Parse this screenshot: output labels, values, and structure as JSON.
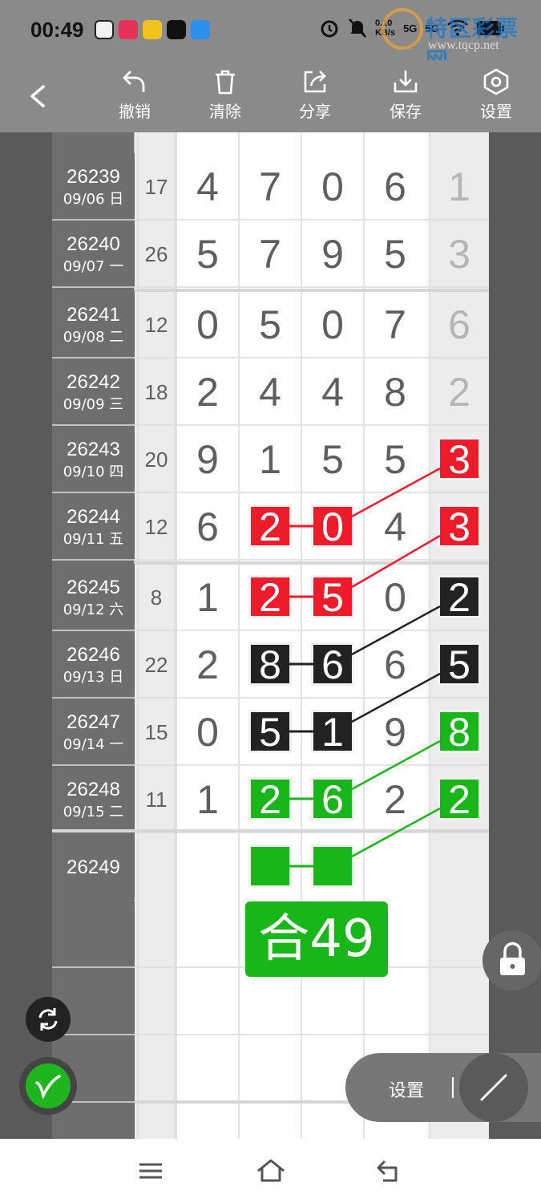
{
  "status": {
    "time": "00:49",
    "net_speed_value": "0.10",
    "net_speed_unit": "KB/s",
    "network_5g_1": "5G",
    "network_5g_2": "5G"
  },
  "watermark": {
    "title": "特区彩票网",
    "url": "www.tqcp.net"
  },
  "toolbar": {
    "undo": "撤销",
    "clear": "清除",
    "share": "分享",
    "save": "保存",
    "settings": "设置"
  },
  "rows": [
    {
      "issue": "26239",
      "date": "09/06 日",
      "sum": "17",
      "d": [
        "4",
        "7",
        "0",
        "6"
      ],
      "last": "1"
    },
    {
      "issue": "26240",
      "date": "09/07 一",
      "sum": "26",
      "d": [
        "5",
        "7",
        "9",
        "5"
      ],
      "last": "3"
    },
    {
      "issue": "26241",
      "date": "09/08 二",
      "sum": "12",
      "d": [
        "0",
        "5",
        "0",
        "7"
      ],
      "last": "6"
    },
    {
      "issue": "26242",
      "date": "09/09 三",
      "sum": "18",
      "d": [
        "2",
        "4",
        "4",
        "8"
      ],
      "last": "2"
    },
    {
      "issue": "26243",
      "date": "09/10 四",
      "sum": "20",
      "d": [
        "9",
        "1",
        "5",
        "5"
      ],
      "last": "3"
    },
    {
      "issue": "26244",
      "date": "09/11 五",
      "sum": "12",
      "d": [
        "6",
        "2",
        "0",
        "4"
      ],
      "last": "3"
    },
    {
      "issue": "26245",
      "date": "09/12 六",
      "sum": "8",
      "d": [
        "1",
        "2",
        "5",
        "0"
      ],
      "last": "2"
    },
    {
      "issue": "26246",
      "date": "09/13 日",
      "sum": "22",
      "d": [
        "2",
        "8",
        "6",
        "6"
      ],
      "last": "5"
    },
    {
      "issue": "26247",
      "date": "09/14 一",
      "sum": "15",
      "d": [
        "0",
        "5",
        "1",
        "9"
      ],
      "last": "8"
    },
    {
      "issue": "26248",
      "date": "09/15 二",
      "sum": "11",
      "d": [
        "1",
        "2",
        "6",
        "2"
      ],
      "last": "2"
    }
  ],
  "next_issue": "26249",
  "result_label": "合49",
  "colors": {
    "red": "#ee1c2a",
    "black": "#222222",
    "green": "#19b619",
    "digit_gray": "#5f5f5f"
  },
  "highlights": [
    {
      "row": 4,
      "cells": [
        4
      ],
      "color": "red"
    },
    {
      "row": 5,
      "cells": [
        1,
        2,
        4
      ],
      "color": "red"
    },
    {
      "row": 6,
      "cells": [
        1,
        2
      ],
      "color": "red"
    },
    {
      "row": 6,
      "cells": [
        4
      ],
      "color": "black"
    },
    {
      "row": 7,
      "cells": [
        1,
        2,
        4
      ],
      "color": "black"
    },
    {
      "row": 8,
      "cells": [
        1,
        2
      ],
      "color": "black"
    },
    {
      "row": 8,
      "cells": [
        4
      ],
      "color": "green"
    },
    {
      "row": 9,
      "cells": [
        1,
        2,
        4
      ],
      "color": "green"
    }
  ],
  "float_settings": "设置",
  "icons": [
    "back-icon",
    "undo-icon",
    "trash-icon",
    "share-icon",
    "download-icon",
    "settings-icon",
    "refresh-icon",
    "pen-icon",
    "lock-icon",
    "line-tool-icon",
    "menu-icon",
    "home-icon",
    "back-nav-icon"
  ]
}
